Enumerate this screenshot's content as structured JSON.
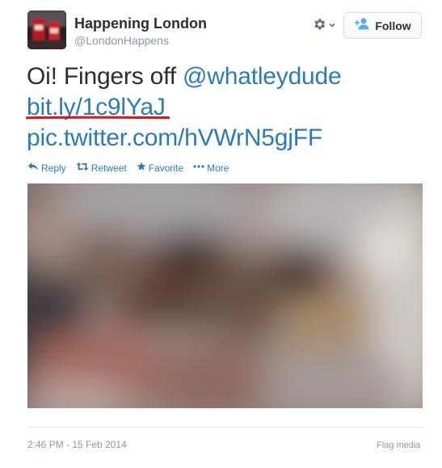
{
  "user": {
    "name": "Happening London",
    "handle": "@LondonHappens"
  },
  "header": {
    "gear_icon": "gear-icon",
    "follow_label": "Follow",
    "follow_icon": "follow-person-plus-icon"
  },
  "tweet": {
    "text_prefix": "Oi! Fingers off ",
    "mention": "@whatleydude",
    "link_short": "bit.ly/1c9lYaJ",
    "link_pic": "pic.twitter.com/hVWrN5gjFF",
    "underline_color": "#cc1f1f"
  },
  "actions": {
    "reply": "Reply",
    "retweet": "Retweet",
    "favorite": "Favorite",
    "more": "More"
  },
  "footer": {
    "timestamp": "2:46 PM - 15 Feb 2014",
    "flag_media": "Flag media"
  },
  "colors": {
    "link": "#2b7bb9",
    "text": "#292f33",
    "muted": "#8899a6"
  }
}
